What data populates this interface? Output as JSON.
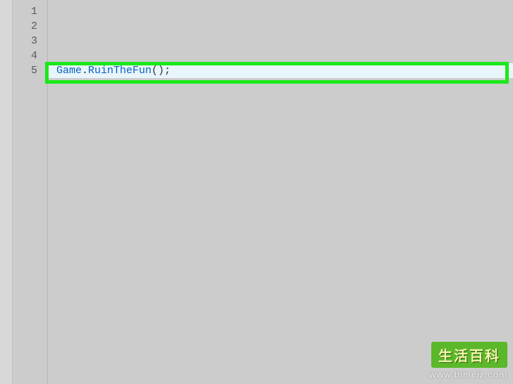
{
  "gutter": {
    "lines": [
      "1",
      "2",
      "3",
      "4",
      "5"
    ]
  },
  "code": {
    "line5": {
      "obj": "Game",
      "dot": ".",
      "method": "RuinTheFun",
      "parens": "()",
      "semi": ";"
    }
  },
  "watermark": {
    "brand": "生活百科",
    "url": "www.bimeiz.com"
  }
}
